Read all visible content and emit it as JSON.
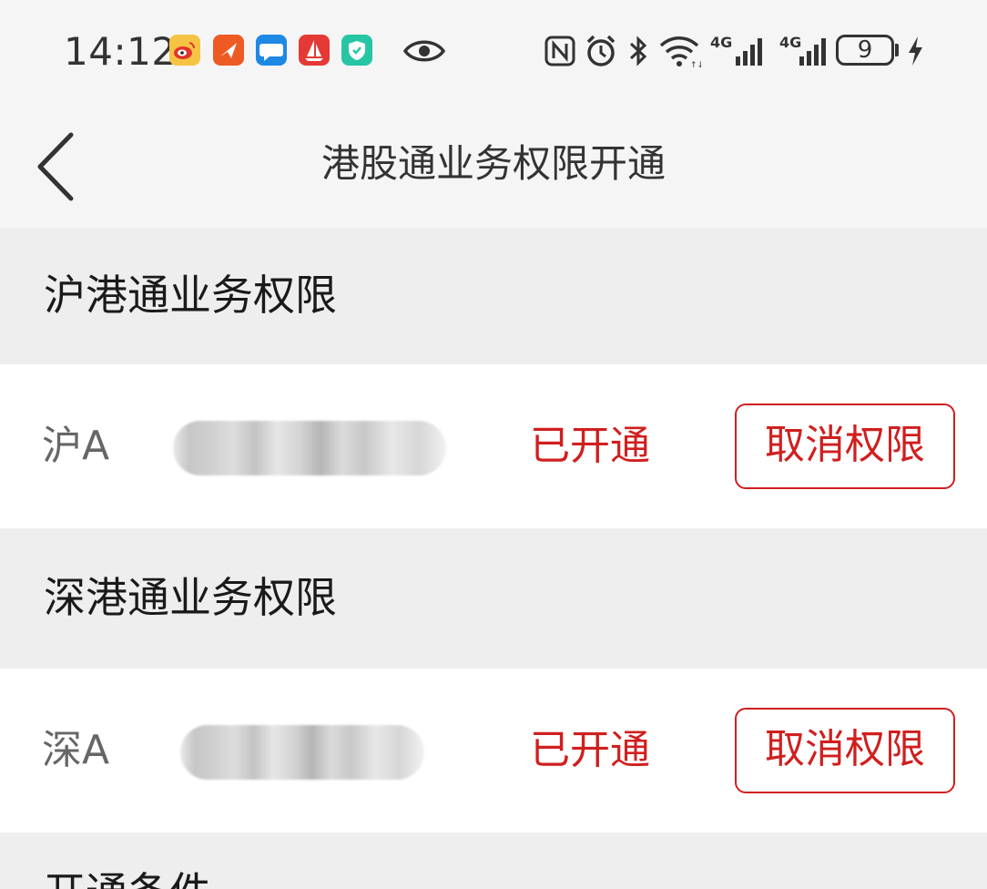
{
  "status_bar": {
    "time": "14:12",
    "notification_icons": [
      "weibo-icon",
      "feishu-icon",
      "message-icon",
      "sail-app-icon",
      "shield-app-icon"
    ],
    "eye_icon": "eye-icon",
    "system_icons": [
      "nfc-icon",
      "alarm-icon",
      "bluetooth-icon",
      "wifi-icon",
      "signal-4g-icon",
      "signal-4g-icon-2"
    ],
    "signal_label_1": "4G",
    "signal_label_2": "4G",
    "battery_level": "9",
    "charging_icon": "charging-bolt-icon"
  },
  "nav": {
    "back_icon": "chevron-left-icon",
    "title": "港股通业务权限开通"
  },
  "sections": [
    {
      "title": "沪港通业务权限",
      "account_type": "沪A",
      "status": "已开通",
      "button_label": "取消权限"
    },
    {
      "title": "深港通业务权限",
      "account_type": "深A",
      "status": "已开通",
      "button_label": "取消权限"
    }
  ],
  "next_section_title": "开通条件",
  "colors": {
    "accent_red": "#d01f1f",
    "background": "#f5f5f5",
    "section_header_bg": "#eeeeee",
    "row_bg": "#ffffff"
  }
}
